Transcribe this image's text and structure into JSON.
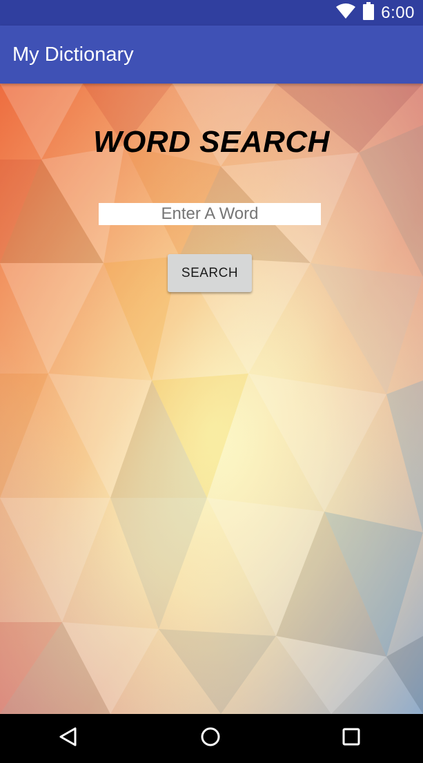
{
  "status_bar": {
    "time": "6:00",
    "icons": [
      "wifi-icon",
      "battery-icon"
    ]
  },
  "app_bar": {
    "title": "My Dictionary",
    "color": "#3f51b5",
    "status_color": "#303f9f"
  },
  "main": {
    "heading": "WORD SEARCH",
    "input_placeholder": "Enter A Word",
    "input_value": "",
    "search_label": "SEARCH"
  },
  "nav_bar": {
    "buttons": [
      "back-icon",
      "home-icon",
      "recents-icon"
    ]
  }
}
